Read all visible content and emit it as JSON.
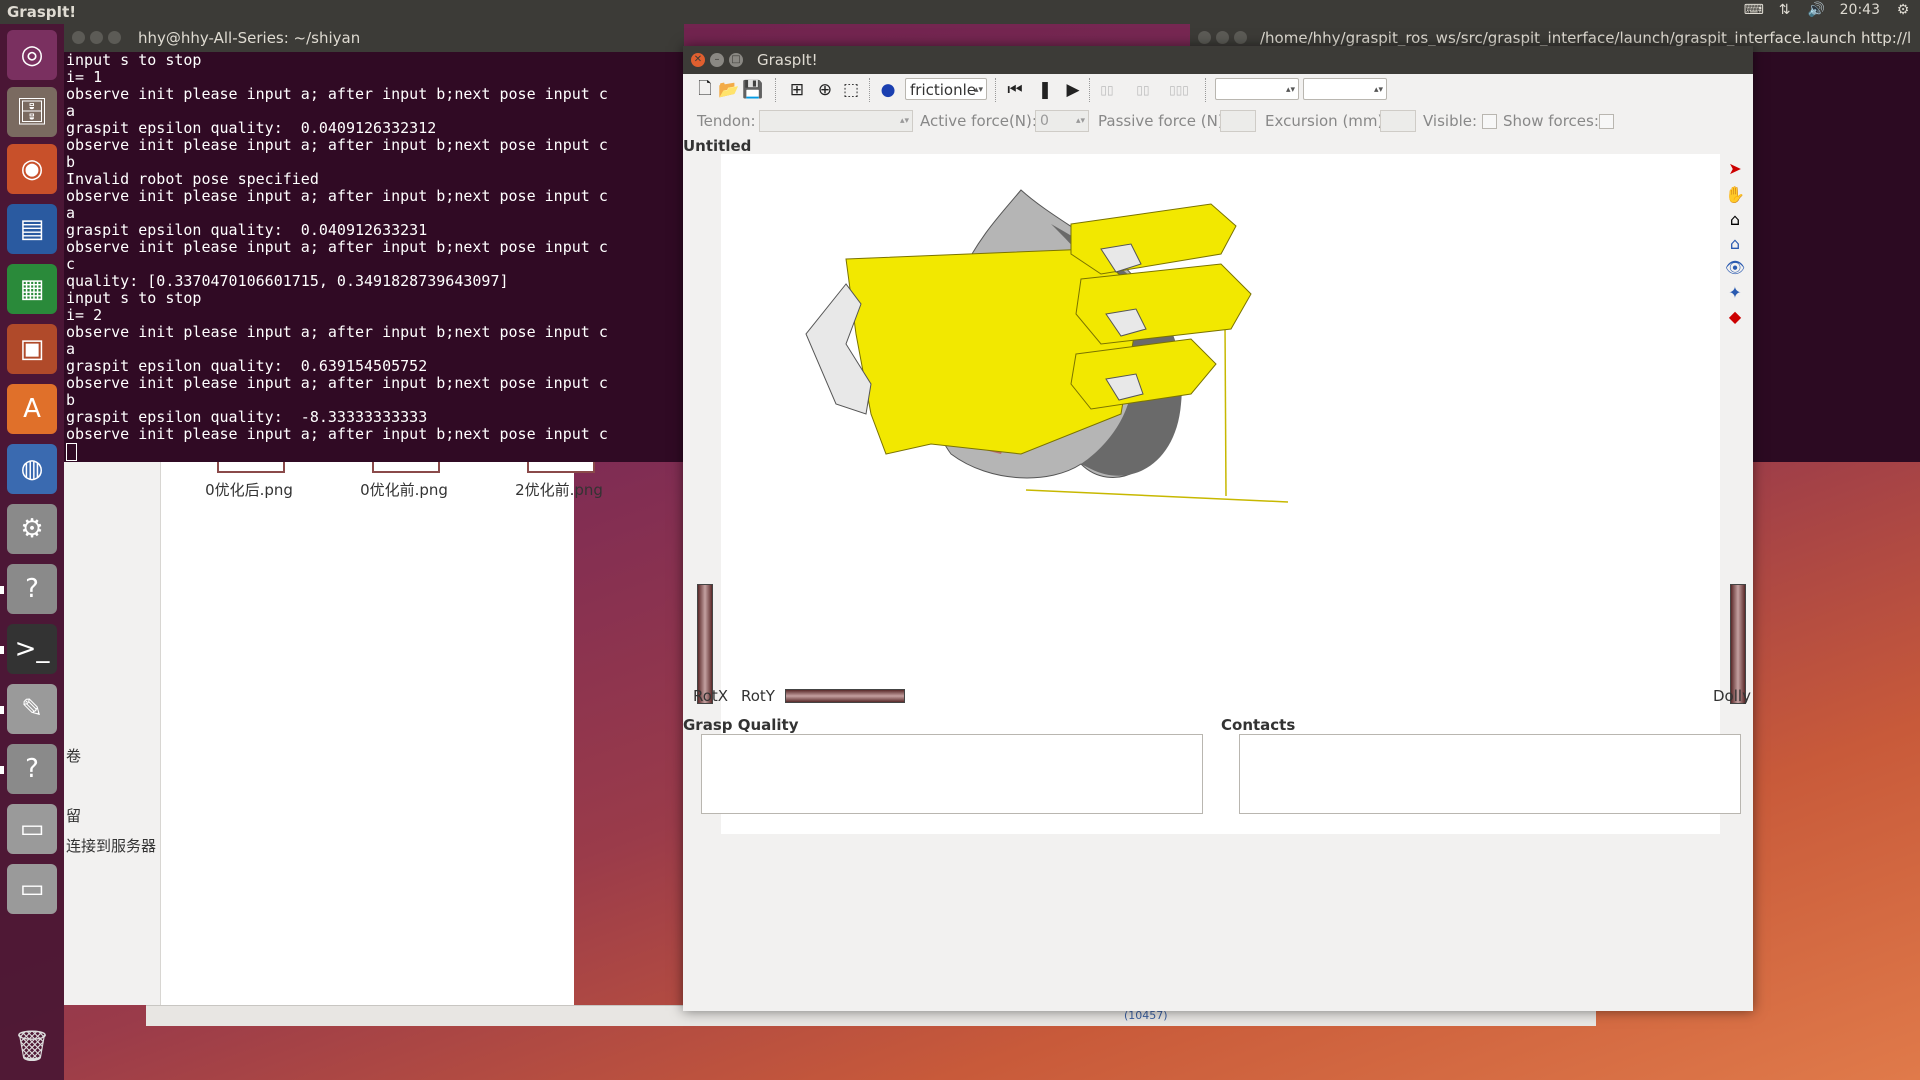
{
  "top_panel": {
    "app_title": "GraspIt!",
    "clock": "20:43"
  },
  "launcher": {
    "items": [
      "ubuntu-dash",
      "files",
      "firefox",
      "writer",
      "calc",
      "impress",
      "software-center",
      "chrome",
      "system-settings",
      "help",
      "terminal",
      "text-editor",
      "help",
      "disk",
      "disk"
    ],
    "trash": "trash"
  },
  "bg_terminal": {
    "title": "/home/hhy/graspit_ros_ws/src/graspit_interface/launch/graspit_interface.launch http://l"
  },
  "file_manager": {
    "files": [
      "0优化后.png",
      "0优化前.png",
      "2优化前.png"
    ],
    "sidebar_fragments": [
      "卷",
      "留",
      "连接到服务器"
    ],
    "status_fragment": "(10457)"
  },
  "terminal": {
    "title": "hhy@hhy-All-Series: ~/shiyan",
    "lines": [
      "input s to stop",
      "i= 1",
      "observe init please input a; after input b;next pose input c",
      "a",
      "graspit epsilon quality:  0.0409126332312",
      "observe init please input a; after input b;next pose input c",
      "b",
      "Invalid robot pose specified",
      "observe init please input a; after input b;next pose input c",
      "a",
      "graspit epsilon quality:  0.040912633231",
      "observe init please input a; after input b;next pose input c",
      "c",
      "quality: [0.3370470106601715, 0.3491828739643097]",
      "input s to stop",
      "i= 2",
      "observe init please input a; after input b;next pose input c",
      "a",
      "graspit epsilon quality:  0.639154505752",
      "observe init please input a; after input b;next pose input c",
      "b",
      "graspit epsilon quality:  -8.33333333333",
      "observe init please input a; after input b;next pose input c"
    ]
  },
  "graspit": {
    "title": "GraspIt!",
    "toolbar": {
      "material_combo": "frictionle",
      "combo_a": "",
      "combo_b": ""
    },
    "toolbar2": {
      "tendon_label": "Tendon:",
      "active_force_label": "Active force(N):",
      "active_force_value": "0",
      "passive_force_label": "Passive force (N):",
      "excursion_label": "Excursion (mm):",
      "visible_label": "Visible:",
      "show_forces_label": "Show forces:"
    },
    "doc_title": "Untitled",
    "wheels": {
      "rotx": "RotX",
      "roty": "RotY",
      "dolly": "Dolly"
    },
    "panels": {
      "grasp_quality": "Grasp Quality",
      "contacts": "Contacts"
    },
    "colors": {
      "hand": "#f2e800",
      "object": "#c8c8c8",
      "viewer_bg": "#ffffff"
    }
  }
}
